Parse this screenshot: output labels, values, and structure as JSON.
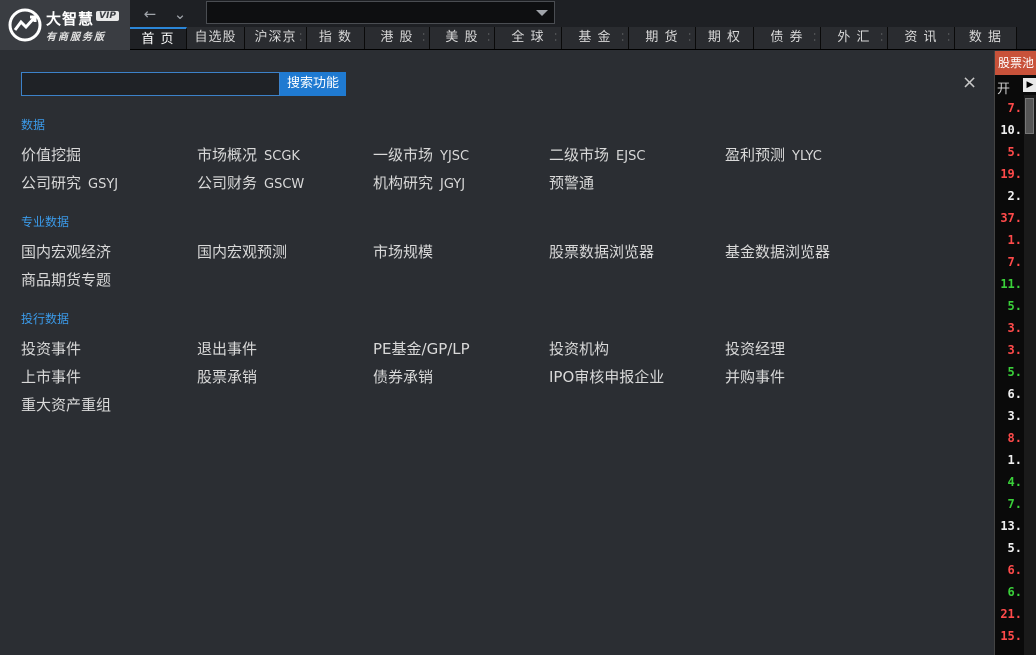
{
  "app": {
    "logo_title": "大智慧",
    "logo_vip": "VIP",
    "logo_sub": "有商服务版"
  },
  "nav": {
    "back": "←",
    "dropdown": "⌄"
  },
  "tabs": [
    {
      "label": "首 页",
      "active": true,
      "dots": false
    },
    {
      "label": "自选股",
      "active": false,
      "dots": false
    },
    {
      "label": "沪深京",
      "active": false,
      "dots": true
    },
    {
      "label": "指 数",
      "active": false,
      "dots": false
    },
    {
      "label": "港 股",
      "active": false,
      "dots": true
    },
    {
      "label": "美 股",
      "active": false,
      "dots": true
    },
    {
      "label": "全 球",
      "active": false,
      "dots": true
    },
    {
      "label": "基 金",
      "active": false,
      "dots": true
    },
    {
      "label": "期 货",
      "active": false,
      "dots": true
    },
    {
      "label": "期 权",
      "active": false,
      "dots": false
    },
    {
      "label": "债 券",
      "active": false,
      "dots": true
    },
    {
      "label": "外 汇",
      "active": false,
      "dots": true
    },
    {
      "label": "资 讯",
      "active": false,
      "dots": true
    },
    {
      "label": "数 据",
      "active": false,
      "dots": false
    }
  ],
  "search": {
    "button_label": "搜索功能",
    "value": ""
  },
  "close_label": "×",
  "sections": [
    {
      "title": "数据",
      "items": [
        {
          "name": "价值挖掘",
          "code": ""
        },
        {
          "name": "市场概况",
          "code": "SCGK"
        },
        {
          "name": "一级市场",
          "code": "YJSC"
        },
        {
          "name": "二级市场",
          "code": "EJSC"
        },
        {
          "name": "盈利预测",
          "code": "YLYC"
        },
        {
          "name": "公司研究",
          "code": "GSYJ"
        },
        {
          "name": "公司财务",
          "code": "GSCW"
        },
        {
          "name": "机构研究",
          "code": "JGYJ"
        },
        {
          "name": "预警通",
          "code": ""
        }
      ]
    },
    {
      "title": "专业数据",
      "items": [
        {
          "name": "国内宏观经济",
          "code": ""
        },
        {
          "name": "国内宏观预测",
          "code": ""
        },
        {
          "name": "市场规模",
          "code": ""
        },
        {
          "name": "股票数据浏览器",
          "code": ""
        },
        {
          "name": "基金数据浏览器",
          "code": ""
        },
        {
          "name": "商品期货专题",
          "code": ""
        }
      ]
    },
    {
      "title": "投行数据",
      "items": [
        {
          "name": "投资事件",
          "code": ""
        },
        {
          "name": "退出事件",
          "code": ""
        },
        {
          "name": "PE基金/GP/LP",
          "code": ""
        },
        {
          "name": "投资机构",
          "code": ""
        },
        {
          "name": "投资经理",
          "code": ""
        },
        {
          "name": "上市事件",
          "code": ""
        },
        {
          "name": "股票承销",
          "code": ""
        },
        {
          "name": "债券承销",
          "code": ""
        },
        {
          "name": "IPO审核申报企业",
          "code": ""
        },
        {
          "name": "并购事件",
          "code": ""
        },
        {
          "name": "重大资产重组",
          "code": ""
        }
      ]
    }
  ],
  "right_panel": {
    "header": "股票池",
    "open_label": "开",
    "colors": {
      "red": "#ff4a4a",
      "green": "#3ad13a",
      "white": "#f0f0f0"
    },
    "values": [
      {
        "v": "7.",
        "c": "red"
      },
      {
        "v": "10.",
        "c": "white"
      },
      {
        "v": "5.",
        "c": "red"
      },
      {
        "v": "19.",
        "c": "red"
      },
      {
        "v": "2.",
        "c": "white"
      },
      {
        "v": "37.",
        "c": "red"
      },
      {
        "v": "1.",
        "c": "red"
      },
      {
        "v": "7.",
        "c": "red"
      },
      {
        "v": "11.",
        "c": "green"
      },
      {
        "v": "5.",
        "c": "green"
      },
      {
        "v": "3.",
        "c": "red"
      },
      {
        "v": "3.",
        "c": "red"
      },
      {
        "v": "5.",
        "c": "green"
      },
      {
        "v": "6.",
        "c": "white"
      },
      {
        "v": "3.",
        "c": "white"
      },
      {
        "v": "8.",
        "c": "red"
      },
      {
        "v": "1.",
        "c": "white"
      },
      {
        "v": "4.",
        "c": "green"
      },
      {
        "v": "7.",
        "c": "green"
      },
      {
        "v": "13.",
        "c": "white"
      },
      {
        "v": "5.",
        "c": "white"
      },
      {
        "v": "6.",
        "c": "red"
      },
      {
        "v": "6.",
        "c": "green"
      },
      {
        "v": "21.",
        "c": "red"
      },
      {
        "v": "15.",
        "c": "red"
      }
    ]
  },
  "colors": {
    "accent": "#1f7ad1",
    "section_title": "#3b9bea",
    "background": "#2b2e33"
  }
}
